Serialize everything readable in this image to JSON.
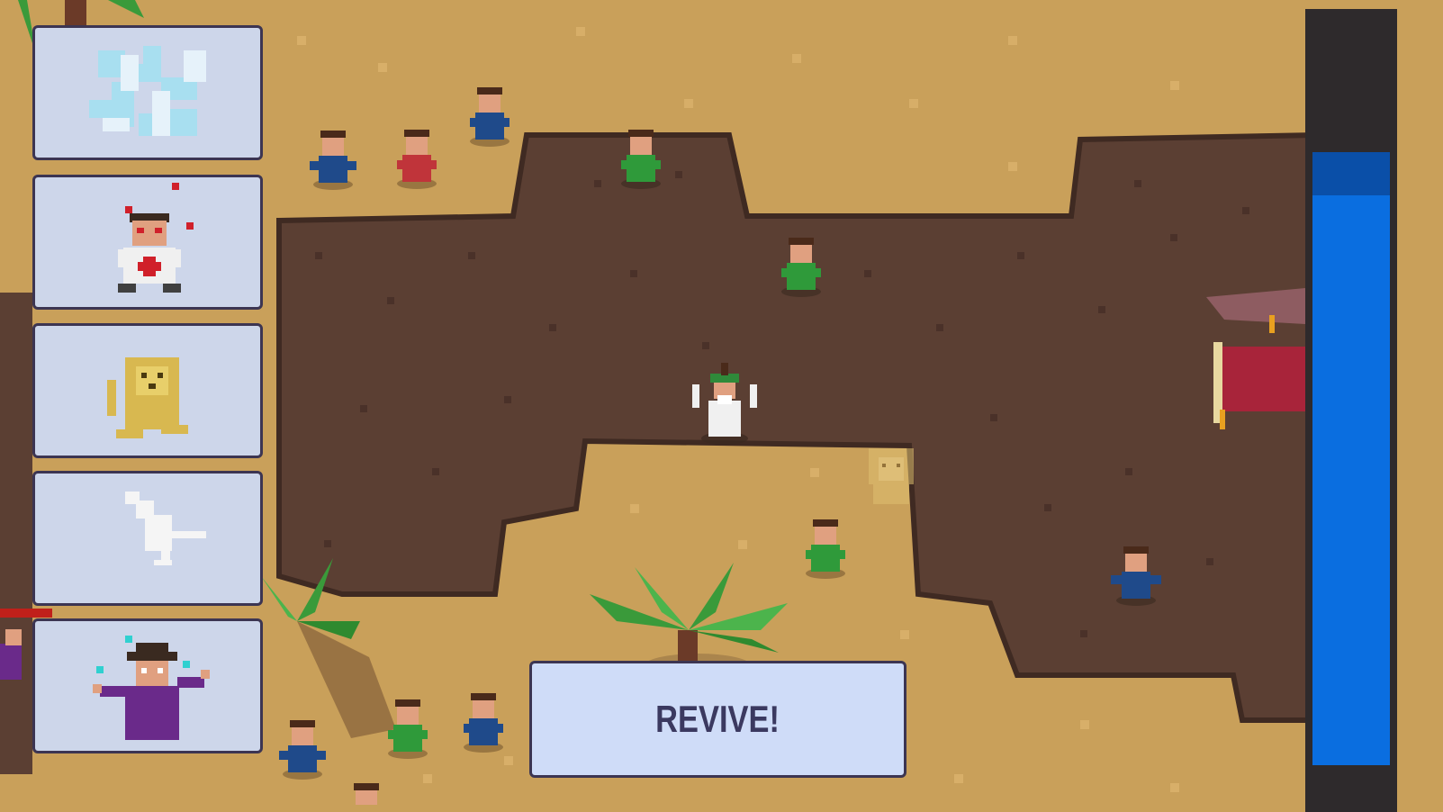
{
  "spell_cards": [
    {
      "name": "frost-spell-icon",
      "kind": "frost"
    },
    {
      "name": "rage-medic-icon",
      "kind": "medic"
    },
    {
      "name": "lion-summon-icon",
      "kind": "lion"
    },
    {
      "name": "dove-spell-icon",
      "kind": "dove"
    },
    {
      "name": "wizard-summon-icon",
      "kind": "wizard"
    }
  ],
  "revive_button": {
    "label": "REVIVE!"
  },
  "mana_bar": {
    "level": 0.82,
    "color": "#0a6ee0"
  },
  "colors": {
    "sand": "#c9a05a",
    "dirt": "#5b3f33",
    "card_bg": "#cdd6ea",
    "card_border": "#3c3552"
  }
}
